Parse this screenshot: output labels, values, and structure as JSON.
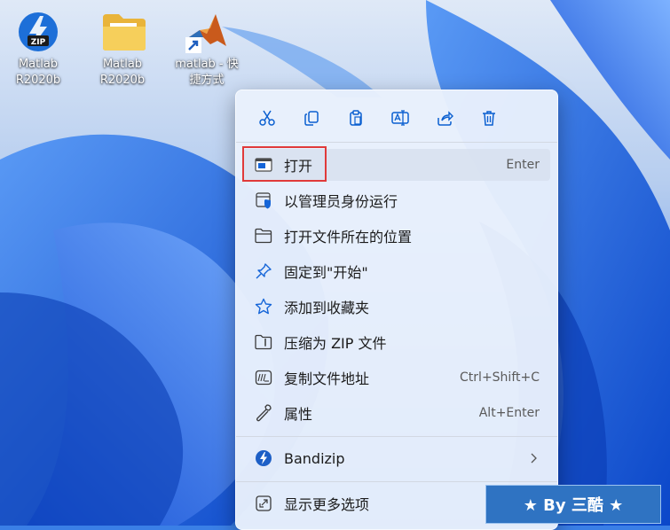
{
  "desktop": {
    "icons": [
      {
        "label": "Matlab\nR2020b",
        "icon": "zip-archive-icon"
      },
      {
        "label": "Matlab\nR2020b",
        "icon": "folder-icon"
      },
      {
        "label": "matlab - 快\n捷方式",
        "icon": "matlab-shortcut-icon"
      }
    ]
  },
  "context_menu": {
    "toolbar": [
      {
        "name": "cut",
        "icon": "scissors-icon"
      },
      {
        "name": "copy",
        "icon": "copy-icon"
      },
      {
        "name": "paste",
        "icon": "clipboard-icon"
      },
      {
        "name": "rename",
        "icon": "rename-icon"
      },
      {
        "name": "share",
        "icon": "share-icon"
      },
      {
        "name": "delete",
        "icon": "trash-icon"
      }
    ],
    "items": [
      {
        "label": "打开",
        "shortcut": "Enter",
        "icon": "window-icon"
      },
      {
        "label": "以管理员身份运行",
        "shortcut": "",
        "icon": "admin-shield-icon"
      },
      {
        "label": "打开文件所在的位置",
        "shortcut": "",
        "icon": "folder-open-icon"
      },
      {
        "label": "固定到\"开始\"",
        "shortcut": "",
        "icon": "pin-icon"
      },
      {
        "label": "添加到收藏夹",
        "shortcut": "",
        "icon": "star-icon"
      },
      {
        "label": "压缩为 ZIP 文件",
        "shortcut": "",
        "icon": "zip-folder-icon"
      },
      {
        "label": "复制文件地址",
        "shortcut": "Ctrl+Shift+C",
        "icon": "copy-path-icon"
      },
      {
        "label": "属性",
        "shortcut": "Alt+Enter",
        "icon": "wrench-icon"
      },
      {
        "label": "Bandizip",
        "shortcut": "",
        "icon": "bandizip-icon"
      },
      {
        "label": "显示更多选项",
        "shortcut": "",
        "icon": "more-options-icon"
      }
    ]
  },
  "watermark": {
    "text": "★ By 三酷 ★"
  },
  "colors": {
    "accent": "#0a5fd0",
    "highlight_border": "#e03a3a"
  }
}
